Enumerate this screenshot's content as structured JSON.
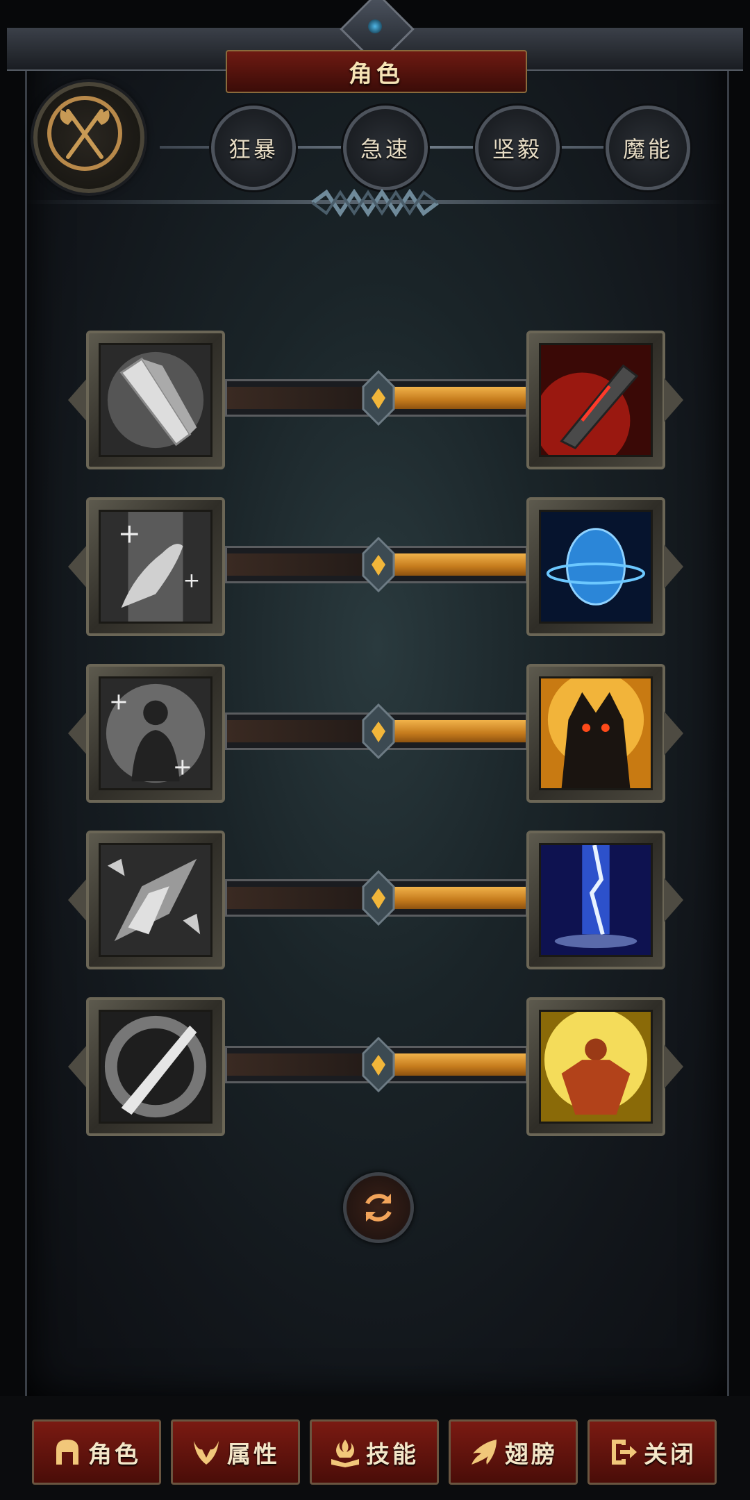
{
  "title": "角色",
  "tabs": [
    {
      "label": "狂暴"
    },
    {
      "label": "急速"
    },
    {
      "label": "坚毅"
    },
    {
      "label": "魔能"
    }
  ],
  "skill_rows": [
    {
      "left_icon": "sword-gray-icon",
      "right_icon": "sword-red-icon",
      "balance": 0.5
    },
    {
      "left_icon": "healing-hand-icon",
      "right_icon": "blue-shield-egg-icon",
      "balance": 0.5
    },
    {
      "left_icon": "figure-heal-icon",
      "right_icon": "demon-warrior-icon",
      "balance": 0.5
    },
    {
      "left_icon": "crystal-shards-icon",
      "right_icon": "lightning-strike-icon",
      "balance": 0.5
    },
    {
      "left_icon": "slash-blade-icon",
      "right_icon": "rage-warrior-icon",
      "balance": 0.5
    }
  ],
  "bottom_nav": [
    {
      "label": "角色",
      "icon": "helmet-icon"
    },
    {
      "label": "属性",
      "icon": "demon-horn-icon"
    },
    {
      "label": "技能",
      "icon": "flame-book-icon"
    },
    {
      "label": "翅膀",
      "icon": "wing-icon"
    },
    {
      "label": "关闭",
      "icon": "exit-icon"
    }
  ],
  "colors": {
    "accent": "#c47a1c",
    "button": "#7a1a12",
    "text": "#f4e6c8"
  }
}
